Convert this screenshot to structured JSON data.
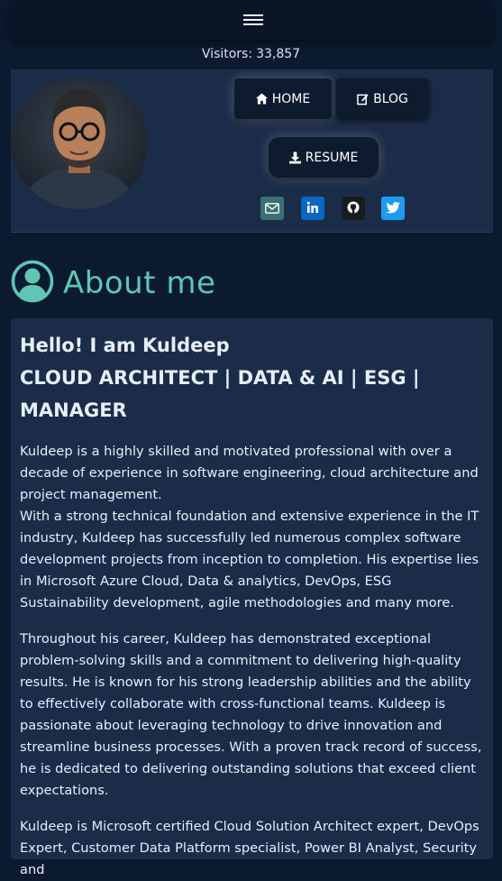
{
  "header": {
    "menu_icon": "hamburger-menu-icon"
  },
  "visitors": {
    "label": "Visitors:",
    "count": "33,857"
  },
  "nav": {
    "home_label": "HOME",
    "blog_label": "BLOG",
    "resume_label": "RESUME",
    "home_icon": "home-icon",
    "blog_icon": "edit-icon",
    "resume_icon": "download-icon"
  },
  "social": [
    {
      "name": "email-icon",
      "color": "#3b6f70"
    },
    {
      "name": "linkedin-icon",
      "color": "#0a66c2"
    },
    {
      "name": "github-icon",
      "color": "#181c21"
    },
    {
      "name": "twitter-icon",
      "color": "#1d9bf0"
    }
  ],
  "about": {
    "title": "About me",
    "icon": "user-circle-icon",
    "accent": "#5fc6b4"
  },
  "content": {
    "greeting": "Hello! I am Kuldeep",
    "role": "CLOUD ARCHITECT | DATA & AI | ESG | MANAGER",
    "p1": "Kuldeep is a highly skilled and motivated professional with over a decade of experience in software engineering, cloud architecture and project management.",
    "p2": "With a strong technical foundation and extensive experience in the IT industry, Kuldeep has successfully led numerous complex software development projects from inception to completion. His expertise lies in Microsoft Azure Cloud, Data & analytics, DevOps, ESG Sustainability development, agile methodologies and many more.",
    "p3": "Throughout his career, Kuldeep has demonstrated exceptional problem-solving skills and a commitment to delivering high-quality results. He is known for his strong leadership abilities and the ability to effectively collaborate with cross-functional teams. Kuldeep is passionate about leveraging technology to drive innovation and streamline business processes. With a proven track record of success, he is dedicated to delivering outstanding solutions that exceed client expectations.",
    "p4": "Kuldeep is Microsoft certified Cloud Solution Architect expert, DevOps Expert, Customer Data Platform specialist, Power BI Analyst, Security and"
  },
  "colors": {
    "background": "#0c1a30",
    "card": "#1b2c48",
    "accent": "#5fc6b4"
  }
}
